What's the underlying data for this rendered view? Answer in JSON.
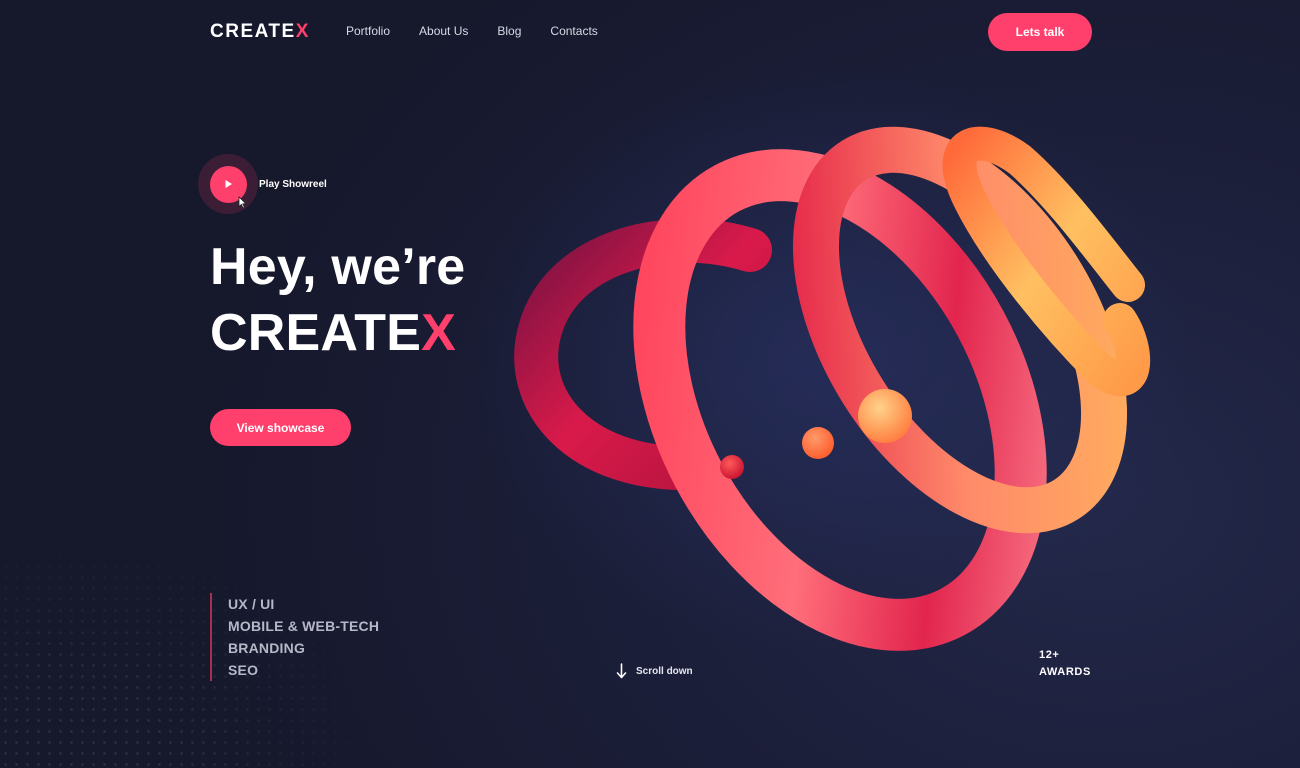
{
  "brand": {
    "name": "CREATE",
    "accent_letter": "X",
    "accent_color": "#ff3f6c",
    "background": "#1b1e38"
  },
  "nav": {
    "items": [
      "Portfolio",
      "About Us",
      "Blog",
      "Contacts"
    ]
  },
  "header": {
    "cta_label": "Lets talk"
  },
  "showreel": {
    "label": "Play Showreel",
    "icon": "play-icon"
  },
  "hero": {
    "line1": "Hey, we’re",
    "line2_main": "CREATE",
    "line2_accent": "X",
    "cta_label": "View showcase"
  },
  "services": [
    "UX / UI",
    "MOBILE & WEB-TECH",
    "BRANDING",
    "SEO"
  ],
  "scroll": {
    "label": "Scroll down",
    "icon": "arrow-down-icon"
  },
  "awards": {
    "count": "12+",
    "label": "AWARDS"
  }
}
